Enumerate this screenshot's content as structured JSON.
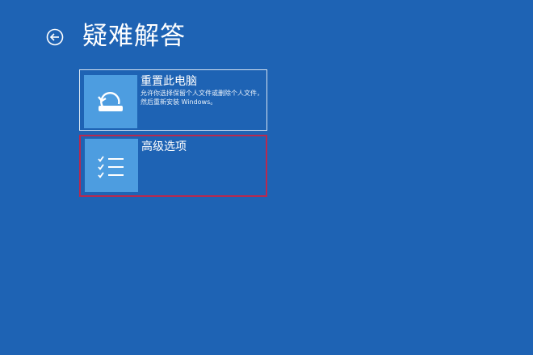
{
  "page": {
    "title": "疑难解答",
    "background_color": "#1e63b4"
  },
  "back": {
    "icon": "back-arrow-icon"
  },
  "options": [
    {
      "title": "重置此电脑",
      "description": "允许你选择保留个人文件或删除个人文件，然后重新安装 Windows。",
      "icon": "reset-pc-icon",
      "tile_color": "#4d9de0"
    },
    {
      "title": "高级选项",
      "description": "",
      "icon": "checklist-icon",
      "tile_color": "#4d9de0",
      "highlight_color": "#b8294f"
    }
  ]
}
